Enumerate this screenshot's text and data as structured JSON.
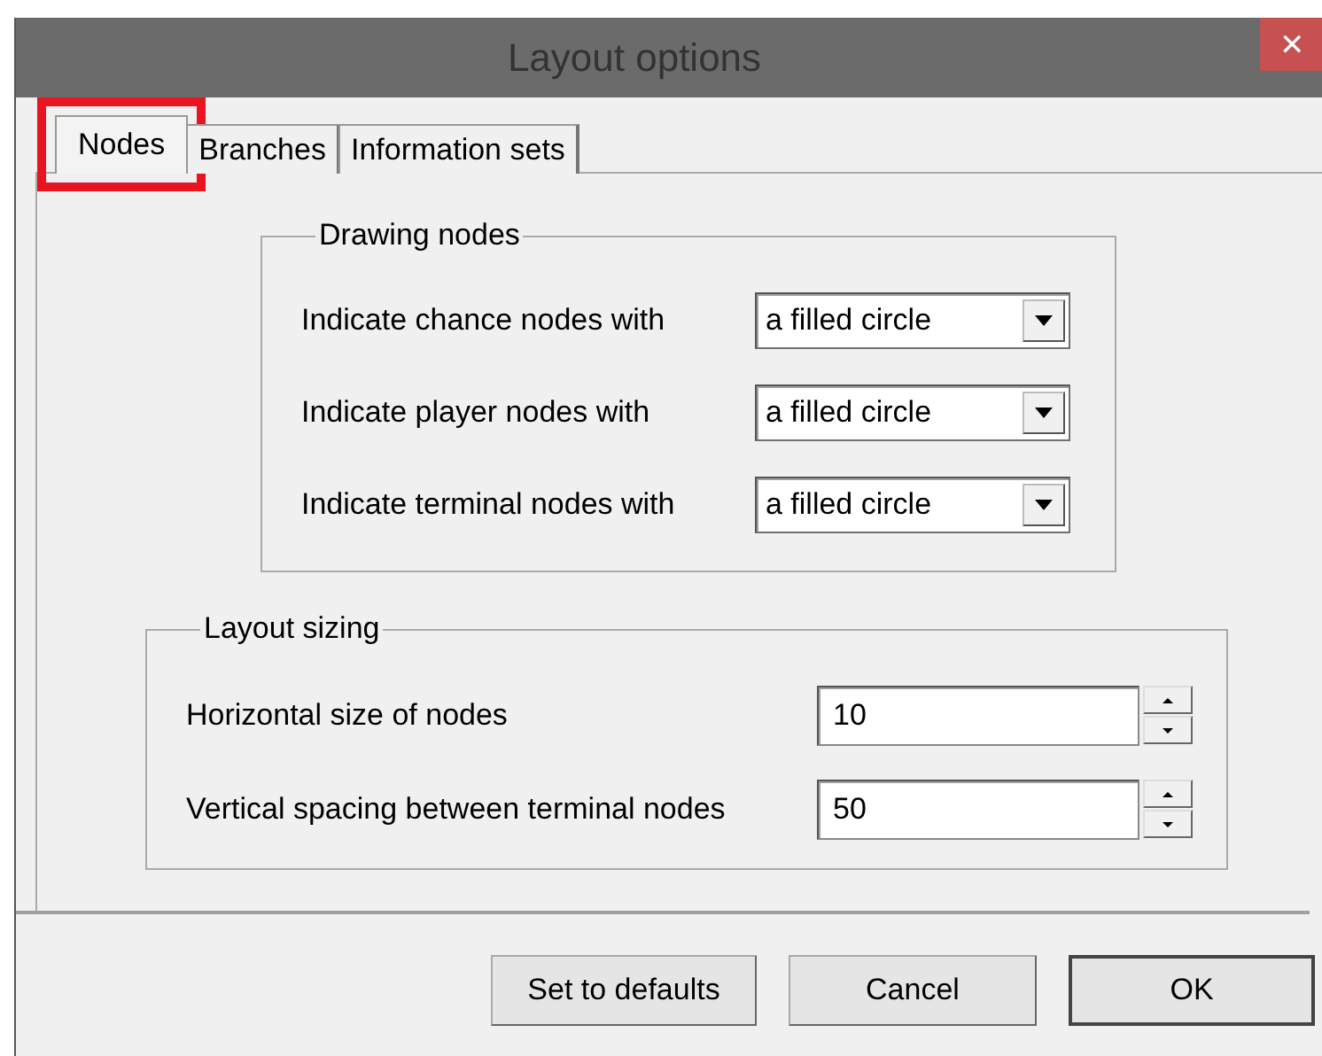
{
  "window": {
    "title": "Layout options",
    "close": "✕"
  },
  "tabs": [
    {
      "label": "Nodes",
      "selected": true,
      "highlighted": true
    },
    {
      "label": "Branches",
      "selected": false,
      "highlighted": false
    },
    {
      "label": "Information sets",
      "selected": false,
      "highlighted": false
    }
  ],
  "groups": [
    {
      "title": "Drawing nodes",
      "kind": "combo",
      "rows": [
        {
          "label": "Indicate chance nodes with",
          "value": "a filled circle"
        },
        {
          "label": "Indicate player nodes with",
          "value": "a filled circle"
        },
        {
          "label": "Indicate terminal nodes with",
          "value": "a filled circle"
        }
      ]
    },
    {
      "title": "Layout sizing",
      "kind": "spin",
      "rows": [
        {
          "label": "Horizontal size of nodes",
          "value": "10"
        },
        {
          "label": "Vertical spacing between terminal nodes",
          "value": "50"
        }
      ]
    }
  ],
  "buttons": [
    {
      "label": "Set to defaults",
      "default": false
    },
    {
      "label": "Cancel",
      "default": false
    },
    {
      "label": "OK",
      "default": true
    }
  ]
}
